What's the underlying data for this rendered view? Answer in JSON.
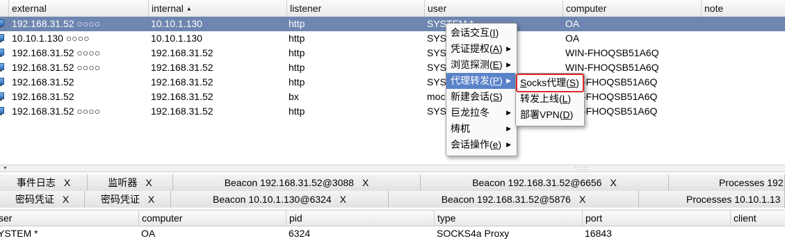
{
  "top_table": {
    "columns": [
      "external",
      "internal",
      "listener",
      "user",
      "computer",
      "note"
    ],
    "sort_indicator": "▲",
    "rows": [
      {
        "external": "192.168.31.52 ○○○○",
        "internal": "10.10.1.130",
        "listener": "http",
        "user": "SYSTEM *",
        "computer": "OA"
      },
      {
        "external": "10.10.1.130 ○○○○",
        "internal": "10.10.1.130",
        "listener": "http",
        "user": "SYST",
        "computer": "OA"
      },
      {
        "external": "192.168.31.52 ○○○○",
        "internal": "192.168.31.52",
        "listener": "http",
        "user": "SYST",
        "computer": "WIN-FHOQSB51A6Q"
      },
      {
        "external": "192.168.31.52 ○○○○",
        "internal": "192.168.31.52",
        "listener": "http",
        "user": "SYST",
        "computer": "WIN-FHOQSB51A6Q"
      },
      {
        "external": "192.168.31.52",
        "internal": "192.168.31.52",
        "listener": "http",
        "user": "SYST",
        "computer": "-FHOQSB51A6Q"
      },
      {
        "external": "192.168.31.52",
        "internal": "192.168.31.52",
        "listener": "bx",
        "user": "moc",
        "computer": "-FHOQSB51A6Q"
      },
      {
        "external": "192.168.31.52 ○○○○",
        "internal": "192.168.31.52",
        "listener": "http",
        "user": "SYST",
        "computer": "-FHOQSB51A6Q"
      }
    ]
  },
  "context_menu": {
    "items": [
      {
        "label": "会话交互(",
        "key": "I",
        "tail": ")",
        "submenu": false
      },
      {
        "label": "凭证提权(",
        "key": "A",
        "tail": ")",
        "submenu": true
      },
      {
        "label": "浏览探测(",
        "key": "E",
        "tail": ")",
        "submenu": true
      },
      {
        "label": "代理转发(",
        "key": "P",
        "tail": ")",
        "submenu": true
      },
      {
        "label": "新建会话(",
        "key": "S",
        "tail": ")",
        "submenu": false
      },
      {
        "label": "巨龙拉冬",
        "key": "",
        "tail": "",
        "submenu": true
      },
      {
        "label": "梼杌",
        "key": "",
        "tail": "",
        "submenu": true
      },
      {
        "label": "会话操作(",
        "key": "e",
        "tail": ")",
        "submenu": true
      }
    ],
    "active_index": 3
  },
  "proxy_submenu": {
    "items": [
      {
        "label_key": "S",
        "label_rest": "ocks代理(",
        "key": "S",
        "tail": ")"
      },
      {
        "label_key": "",
        "label_rest": "转发上线(",
        "key": "L",
        "tail": ")"
      },
      {
        "label_key": "",
        "label_rest": "部署VPN(",
        "key": "D",
        "tail": ")"
      }
    ],
    "highlighted_index": 0
  },
  "tabs_row1": [
    {
      "label": "事件日志",
      "close": "X"
    },
    {
      "label": "监听器",
      "close": "X"
    },
    {
      "label": "Beacon 192.168.31.52@3088",
      "close": "X"
    },
    {
      "label": "Beacon 192.168.31.52@6656",
      "close": "X"
    },
    {
      "label": "Processes 192",
      "close": ""
    }
  ],
  "tabs_row2": [
    {
      "label": "密码凭证",
      "close": "X"
    },
    {
      "label": "密码凭证",
      "close": "X"
    },
    {
      "label": "Beacon 10.10.1.130@6324",
      "close": "X"
    },
    {
      "label": "Beacon 192.168.31.52@5876",
      "close": "X"
    },
    {
      "label": "Processes 10.10.1.13",
      "close": ""
    }
  ],
  "bottom_table": {
    "columns": [
      "ser",
      "computer",
      "pid",
      "type",
      "port",
      "client"
    ],
    "rows": [
      {
        "user": "YSTEM *",
        "computer": "OA",
        "pid": "6324",
        "type": "SOCKS4a Proxy",
        "port": "16843",
        "client": ""
      }
    ]
  },
  "colors": {
    "selection": "#6e86b0",
    "menu_active": "#5a82c8",
    "highlight_box": "#e0292b"
  }
}
